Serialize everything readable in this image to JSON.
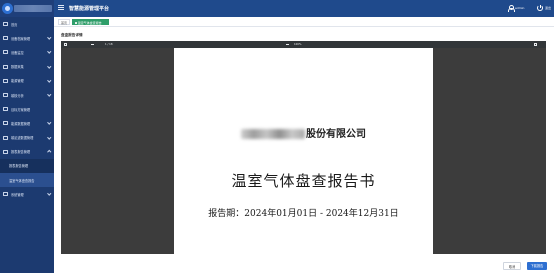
{
  "header": {
    "title": "智慧能源管理平台",
    "user_name": "admin",
    "logout_label": "退出"
  },
  "sidebar": {
    "items": [
      {
        "label": "首页"
      },
      {
        "label": "设备档案管理"
      },
      {
        "label": "设备监控"
      },
      {
        "label": "数据采集"
      },
      {
        "label": "能源管理"
      },
      {
        "label": "碳核分析"
      },
      {
        "label": "目标方案管理"
      },
      {
        "label": "能源数据管理"
      },
      {
        "label": "碳足迹数据管理"
      },
      {
        "label": "报表报告管理"
      },
      {
        "label": "报表报告管理"
      },
      {
        "label": "温室气体盘查报告"
      },
      {
        "label": "系统管理"
      }
    ]
  },
  "tabs": [
    {
      "label": "首页"
    },
    {
      "label": "温室气体盘查报告"
    }
  ],
  "content": {
    "section_title": "盘查报告详情"
  },
  "pdf_toolbar": {
    "page_indicator": "1 / 18",
    "zoom": "100%"
  },
  "pdf_page": {
    "company_suffix": "股份有限公司",
    "report_title": "温室气体盘查报告书",
    "report_period": "报告期：2024年01月01日 - 2024年12月31日"
  },
  "buttons": {
    "back": "取消",
    "download": "下载报告"
  },
  "colors": {
    "sidebar_bg": "#1c3a70",
    "header_bg": "#1f4a8c",
    "active_tab": "#2f9e6a",
    "primary_button": "#2d6fd1"
  }
}
